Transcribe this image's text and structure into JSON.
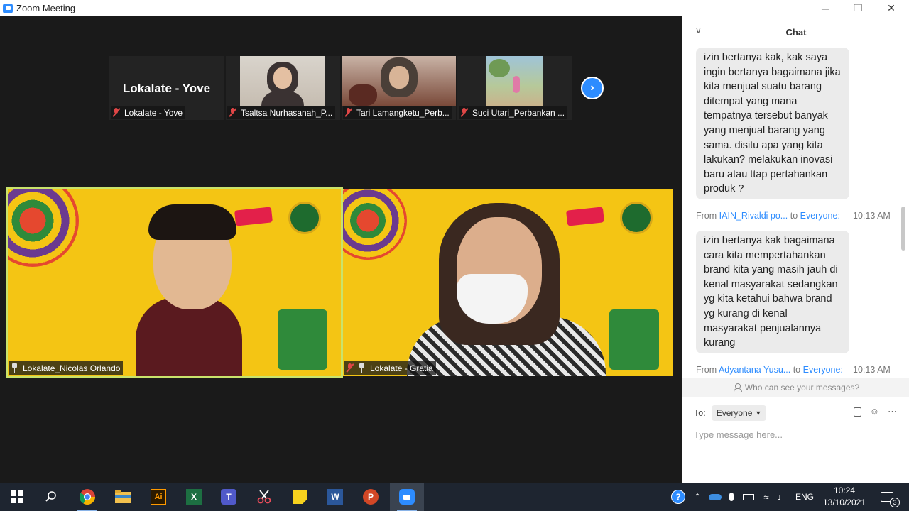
{
  "window": {
    "title": "Zoom Meeting",
    "minimize": "─",
    "maximize": "❐",
    "close": "✕"
  },
  "thumbnails": [
    {
      "display_name": "Lokalate - Yove",
      "name": "Lokalate - Yove",
      "video": false
    },
    {
      "display_name": "",
      "name": "Tsaltsa Nurhasanah_P...",
      "video": true
    },
    {
      "display_name": "",
      "name": "Tari Lamangketu_Perb...",
      "video": true
    },
    {
      "display_name": "",
      "name": "Suci Utari_Perbankan ...",
      "video": true
    }
  ],
  "next_page_icon": "›",
  "speakers": [
    {
      "name": "Lokalate_Nicolas Orlando",
      "active": true
    },
    {
      "name": "Lokalate - Gratia",
      "active": false
    }
  ],
  "chat": {
    "title": "Chat",
    "collapse_icon": "chevron-down",
    "messages": [
      {
        "text": "izin bertanya kak, kak saya ingin bertanya bagaimana jika kita menjual suatu barang ditempat yang mana tempatnya tersebut banyak yang menjual barang yang sama. disitu apa yang kita lakukan? melakukan inovasi baru atau ttap pertahankan produk ?"
      },
      {
        "from_label": "From",
        "sender": "IAIN_Rivaldi po...",
        "to_label": "to",
        "recipient": "Everyone:",
        "time": "10:13 AM",
        "text": "izin bertanya kak bagaimana cara kita mempertahankan brand kita yang masih jauh di kenal masyarakat sedangkan yg kita ketahui bahwa brand yg kurang di kenal masyarakat penjualannya kurang"
      },
      {
        "from_label": "From",
        "sender": "Adyantana Yusu...",
        "to_label": "to",
        "recipient": "Everyone:",
        "time": "10:13 AM"
      }
    ],
    "privacy_note": "Who can see your messages?",
    "to_label": "To:",
    "to_value": "Everyone",
    "input_placeholder": "Type message here..."
  },
  "taskbar": {
    "apps": [
      "start",
      "search",
      "chrome",
      "file-explorer",
      "illustrator",
      "excel",
      "teams",
      "snipping",
      "sticky-notes",
      "word",
      "powerpoint",
      "zoom"
    ],
    "language": "ENG",
    "time": "10:24",
    "date": "13/10/2021",
    "notification_count": "3"
  },
  "colors": {
    "zoom_blue": "#2d8cff",
    "meeting_bg": "#1a1a1a",
    "speaker_bg": "#f4c514",
    "active_border": "#c9e36b",
    "mute_red": "#e04646"
  }
}
